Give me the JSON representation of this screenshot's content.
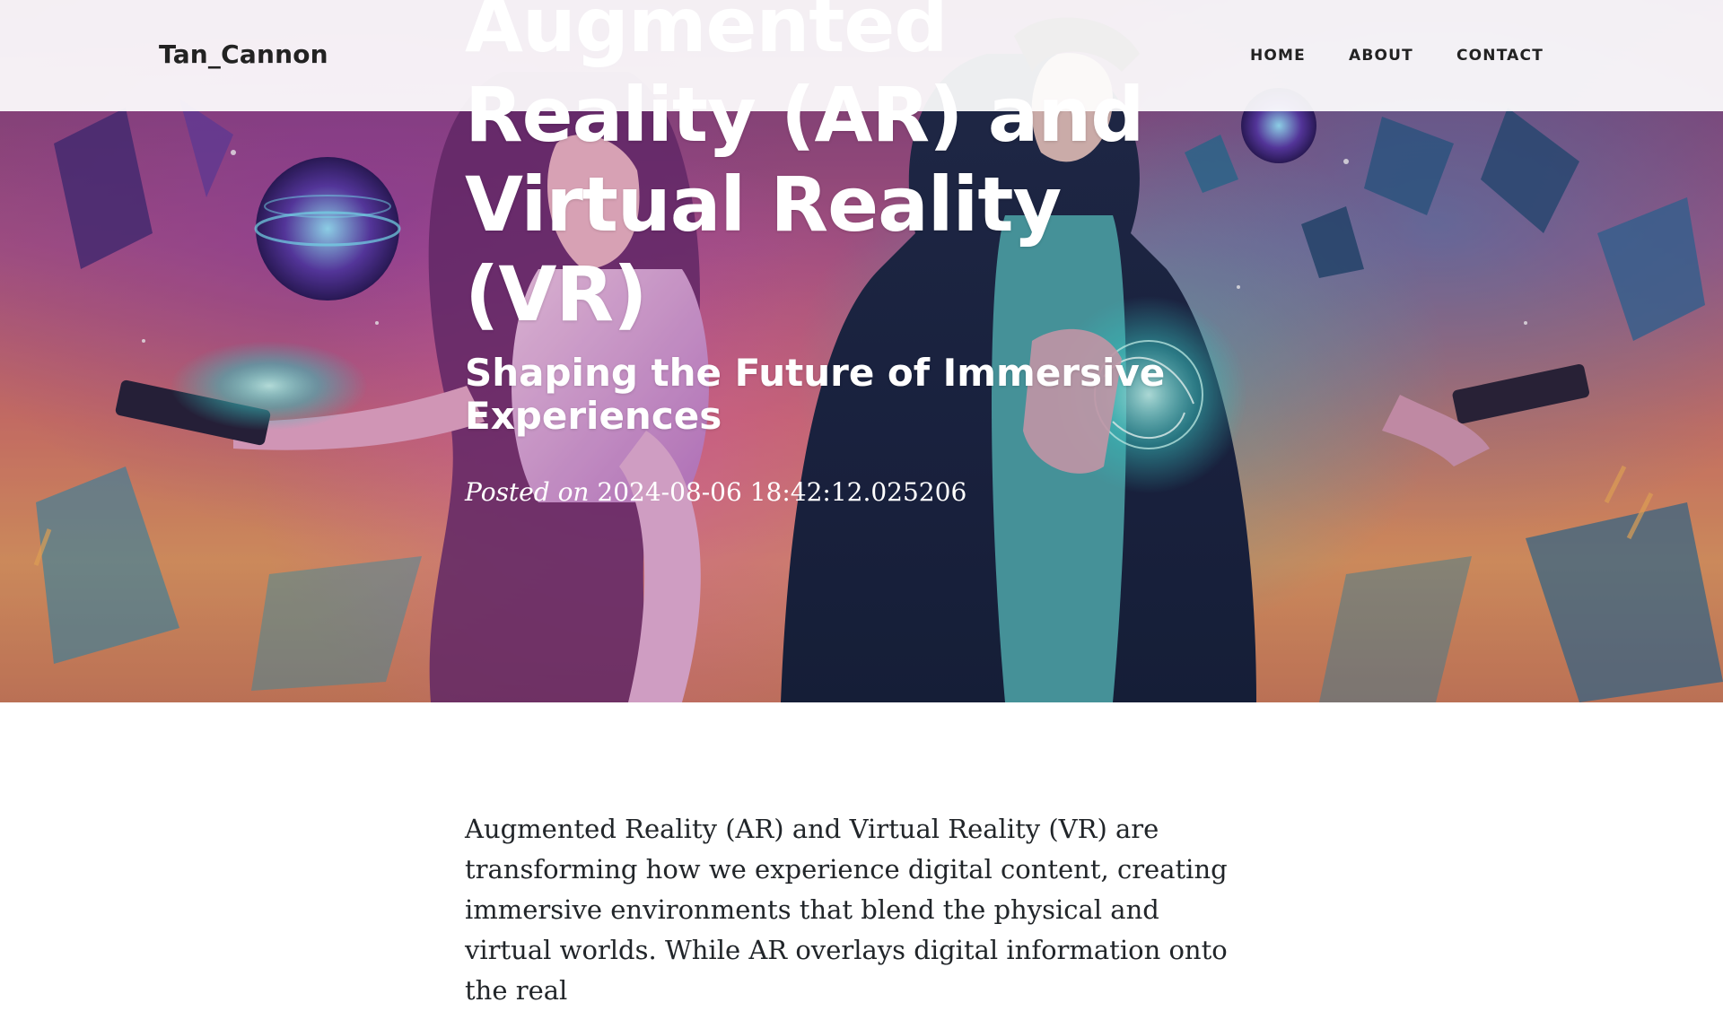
{
  "navbar": {
    "brand": "Tan_Cannon",
    "links": [
      {
        "label": "HOME"
      },
      {
        "label": "ABOUT"
      },
      {
        "label": "CONTACT"
      }
    ]
  },
  "hero": {
    "title": "Augmented Reality (AR) and Virtual Reality (VR)",
    "subtitle": "Shaping the Future of Immersive Experiences",
    "meta_prefix": "Posted on",
    "meta_date": "2024-08-06 18:42:12.025206"
  },
  "article": {
    "paragraph": "Augmented Reality (AR) and Virtual Reality (VR) are transforming how we experience digital content, creating immersive environments that blend the physical and virtual worlds. While AR overlays digital information onto the real"
  },
  "colors": {
    "navbar_bg": "#ffffff",
    "text_dark": "#212529",
    "hero_text": "#ffffff"
  }
}
